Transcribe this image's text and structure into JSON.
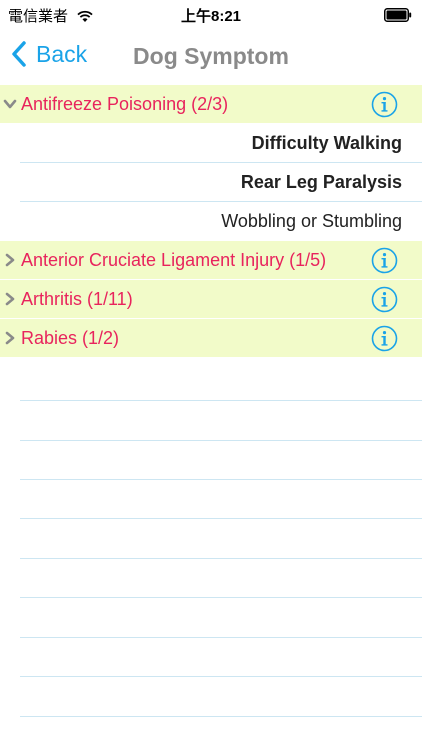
{
  "status_bar": {
    "carrier": "電信業者",
    "time": "上午8:21",
    "wifi_icon": "wifi-icon",
    "battery_icon": "battery-icon"
  },
  "nav": {
    "back_label": "Back",
    "title": "Dog Symptom",
    "accent_color": "#1aa3e8"
  },
  "categories": [
    {
      "label": "Antifreeze Poisoning (2/3)",
      "expanded": true,
      "symptoms": [
        {
          "label": "Difficulty Walking",
          "bold": true
        },
        {
          "label": "Rear Leg Paralysis",
          "bold": true
        },
        {
          "label": "Wobbling or Stumbling",
          "bold": false
        }
      ]
    },
    {
      "label": "Anterior Cruciate Ligament Injury (1/5)",
      "expanded": false
    },
    {
      "label": "Arthritis (1/11)",
      "expanded": false
    },
    {
      "label": "Rabies (1/2)",
      "expanded": false
    }
  ],
  "colors": {
    "category_background": "#f2fbc9",
    "category_text": "#e8245d",
    "separator": "#cde6f2"
  }
}
